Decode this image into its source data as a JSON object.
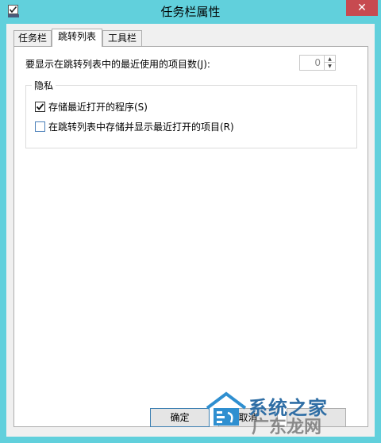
{
  "window": {
    "title": "任务栏属性",
    "close_glyph": "✕"
  },
  "tabs": [
    {
      "label": "任务栏"
    },
    {
      "label": "跳转列表"
    },
    {
      "label": "工具栏"
    }
  ],
  "jumplist": {
    "recent_count_label": "要显示在跳转列表中的最近使用的项目数(J):",
    "recent_count_value": "0",
    "privacy_group_title": "隐私",
    "store_recent_programs_label": "存储最近打开的程序(S)",
    "store_recent_items_label": "在跳转列表中存储并显示最近打开的项目(R)"
  },
  "buttons": {
    "ok": "确定",
    "cancel": "取消",
    "apply": ""
  },
  "watermark": {
    "line1": "系统之家",
    "line2": "广东龙网"
  },
  "colors": {
    "frame": "#61d0dc",
    "close": "#c74a50",
    "accent_blue": "#2f6ea5"
  }
}
